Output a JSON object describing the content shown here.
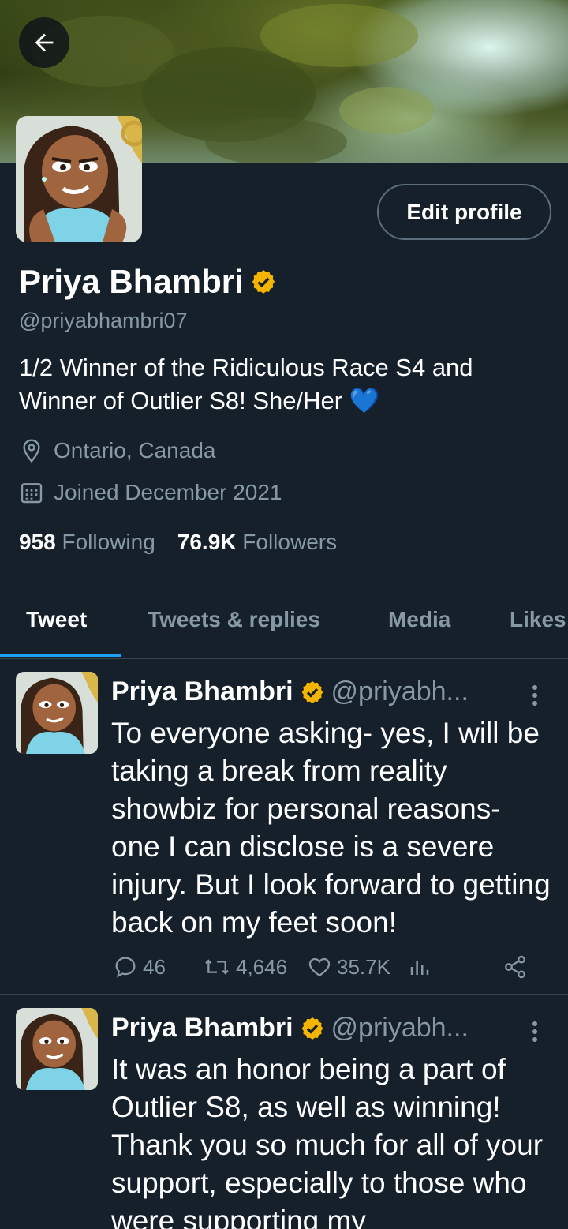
{
  "header": {
    "back_icon": "arrow-left-icon",
    "edit_profile_label": "Edit profile"
  },
  "profile": {
    "display_name": "Priya Bhambri",
    "verified": true,
    "handle": "@priyabhambri07",
    "bio": "1/2 Winner of the Ridiculous Race S4 and Winner of Outlier S8! She/Her 💙",
    "location": "Ontario, Canada",
    "joined": "Joined December 2021",
    "following_count": "958",
    "following_label": "Following",
    "followers_count": "76.9K",
    "followers_label": "Followers"
  },
  "tabs": [
    {
      "label": "Tweet",
      "active": true
    },
    {
      "label": "Tweets & replies",
      "active": false
    },
    {
      "label": "Media",
      "active": false
    },
    {
      "label": "Likes",
      "active": false
    }
  ],
  "tweets": [
    {
      "name": "Priya Bhambri",
      "handle": "@priyabh...",
      "text": "To everyone asking- yes, I will be taking a break from reality showbiz for personal reasons- one I can disclose is a severe injury. But I look forward to getting back on my feet soon!",
      "replies": "46",
      "retweets": "4,646",
      "likes": "35.7K"
    },
    {
      "name": "Priya Bhambri",
      "handle": "@priyabh...",
      "text": "It was an honor being a part of Outlier S8, as well as winning! Thank you so much for all of your support, especially to those who were supporting my"
    }
  ],
  "colors": {
    "background": "#15202b",
    "accent": "#1da1f2",
    "muted": "#8899a6",
    "verified": "#f4b400",
    "heart": "#5dadec"
  }
}
